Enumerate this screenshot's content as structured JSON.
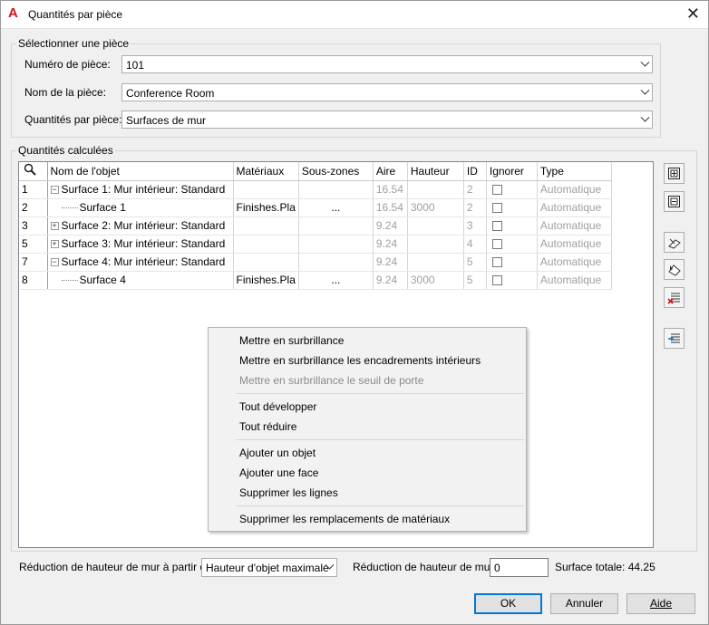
{
  "window": {
    "title": "Quantités par pièce",
    "close": "✕"
  },
  "select_group": {
    "legend": "Sélectionner une pièce",
    "room_number_label": "Numéro de pièce:",
    "room_number_value": "101",
    "room_name_label": "Nom de la pièce:",
    "room_name_value": "Conference Room",
    "quantities_label": "Quantités par pièce:",
    "quantities_value": "Surfaces de mur"
  },
  "calc_group": {
    "legend": "Quantités calculées",
    "columns": [
      "Nom de l'objet",
      "Matériaux",
      "Sous-zones",
      "Aire",
      "Hauteur",
      "ID",
      "Ignorer",
      "Type"
    ],
    "rows": [
      {
        "num": "1",
        "name": "Surface 1: Mur intérieur: Standard",
        "materials": "",
        "subzones": "",
        "area": "16.54",
        "height": "",
        "id": "2",
        "type": "Automatique"
      },
      {
        "num": "2",
        "name": "Surface 1",
        "materials": "Finishes.Pla",
        "subzones": "...",
        "area": "16.54",
        "height": "3000",
        "id": "2",
        "type": "Automatique"
      },
      {
        "num": "3",
        "name": "Surface 2: Mur intérieur: Standard",
        "materials": "",
        "subzones": "",
        "area": "9.24",
        "height": "",
        "id": "3",
        "type": "Automatique"
      },
      {
        "num": "5",
        "name": "Surface 3: Mur intérieur: Standard",
        "materials": "",
        "subzones": "",
        "area": "9.24",
        "height": "",
        "id": "4",
        "type": "Automatique"
      },
      {
        "num": "7",
        "name": "Surface 4: Mur intérieur: Standard",
        "materials": "",
        "subzones": "",
        "area": "9.24",
        "height": "",
        "id": "5",
        "type": "Automatique"
      },
      {
        "num": "8",
        "name": "Surface 4",
        "materials": "Finishes.Pla",
        "subzones": "...",
        "area": "9.24",
        "height": "3000",
        "id": "5",
        "type": "Automatique"
      }
    ]
  },
  "context_menu": {
    "items": [
      "Mettre en surbrillance",
      "Mettre en surbrillance les encadrements intérieurs",
      "Mettre en surbrillance le seuil de porte",
      "Tout développer",
      "Tout réduire",
      "Ajouter un objet",
      "Ajouter une face",
      "Supprimer les lignes",
      "Supprimer les remplacements de matériaux"
    ]
  },
  "bottom": {
    "reduction_from_label": "Réduction de hauteur de mur à partir de",
    "reduction_from_value": "Hauteur d'objet maximale",
    "reduction_label": "Réduction de hauteur de mur",
    "reduction_value": "0",
    "total_label": "Surface totale: 44.25"
  },
  "buttons": {
    "ok": "OK",
    "cancel": "Annuler",
    "help": "Aide"
  },
  "colors": {
    "accent": "#0078d7",
    "app_icon": "#d3111c"
  }
}
